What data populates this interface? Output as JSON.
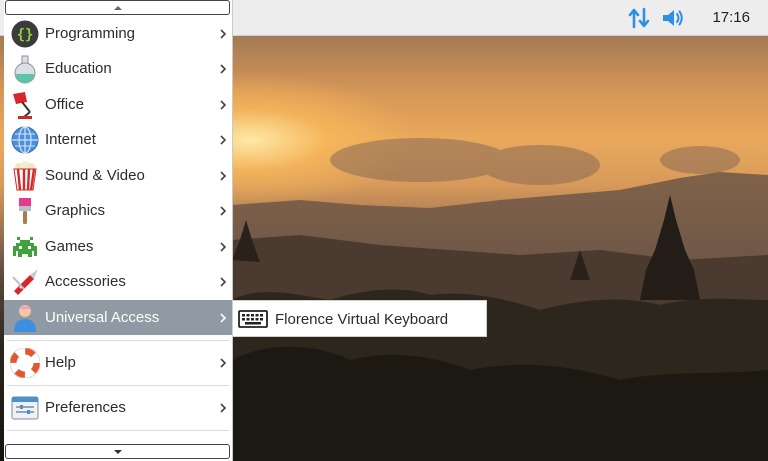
{
  "panel": {
    "clock": "17:16",
    "icons": [
      "network-arrows-icon",
      "volume-icon"
    ],
    "accent_color": "#2d8fe6"
  },
  "menu": {
    "items": [
      {
        "label": "Programming",
        "icon": "programming-icon"
      },
      {
        "label": "Education",
        "icon": "education-flask-icon"
      },
      {
        "label": "Office",
        "icon": "office-lamp-icon"
      },
      {
        "label": "Internet",
        "icon": "internet-globe-icon"
      },
      {
        "label": "Sound & Video",
        "icon": "sound-video-popcorn-icon"
      },
      {
        "label": "Graphics",
        "icon": "graphics-paintbrush-icon"
      },
      {
        "label": "Games",
        "icon": "games-invader-icon"
      },
      {
        "label": "Accessories",
        "icon": "accessories-knife-icon"
      },
      {
        "label": "Universal Access",
        "icon": "universal-access-person-icon"
      },
      {
        "label": "Help",
        "icon": "help-lifebuoy-icon"
      },
      {
        "label": "Preferences",
        "icon": "preferences-panel-icon"
      }
    ],
    "highlight_color": "#8f9aa4"
  },
  "submenu": {
    "items": [
      {
        "label": "Florence Virtual Keyboard",
        "icon": "keyboard-icon"
      }
    ]
  }
}
